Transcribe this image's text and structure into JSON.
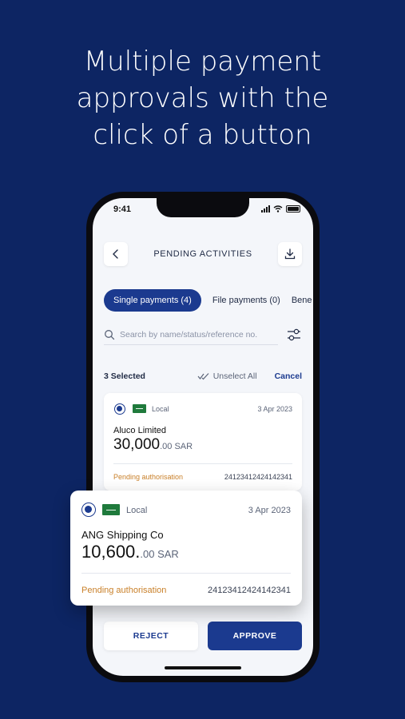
{
  "headline": {
    "line1": "Multiple payment",
    "line2": "approvals with the",
    "line3": "click of a button"
  },
  "status_bar": {
    "time": "9:41"
  },
  "header": {
    "title": "PENDING ACTIVITIES"
  },
  "tabs": [
    {
      "label": "Single payments (4)",
      "active": true
    },
    {
      "label": "File payments (0)",
      "active": false
    },
    {
      "label": "Bene",
      "active": false
    }
  ],
  "search": {
    "placeholder": "Search by name/status/reference no."
  },
  "selection": {
    "count_label": "3 Selected",
    "unselect_label": "Unselect All",
    "cancel_label": "Cancel"
  },
  "payments": [
    {
      "type": "Local",
      "date": "3 Apr 2023",
      "name": "Aluco Limited",
      "amount_int": "30,000",
      "amount_dec": ".00 SAR",
      "status": "Pending authorisation",
      "reference": "24123412424142341"
    },
    {
      "type": "Local",
      "date": "3 Apr 2023",
      "name": "ANG Shipping Co",
      "amount_int": "10,600.",
      "amount_dec": ".00 SAR",
      "status": "Pending authorisation",
      "reference": "24123412424142341"
    }
  ],
  "actions": {
    "reject_label": "REJECT",
    "approve_label": "APPROVE"
  },
  "colors": {
    "background": "#0d2563",
    "primary": "#1b3a8f",
    "pending": "#c9802a"
  },
  "icons": [
    "back-chevron-icon",
    "download-icon",
    "search-icon",
    "filter-icon",
    "double-check-icon",
    "flag-icon"
  ]
}
